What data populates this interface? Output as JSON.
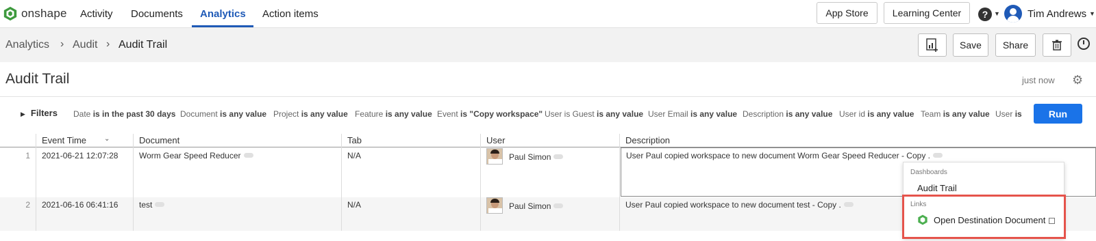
{
  "nav": {
    "brand": "onshape",
    "items": [
      "Activity",
      "Documents",
      "Analytics",
      "Action items"
    ],
    "active": "Analytics",
    "app_store": "App Store",
    "learning_center": "Learning Center",
    "help_icon": "question-circle-icon",
    "user_name": "Tim Andrews"
  },
  "breadcrumb": [
    "Analytics",
    "Audit",
    "Audit Trail"
  ],
  "toolbar": {
    "save": "Save",
    "share": "Share"
  },
  "page": {
    "title": "Audit Trail",
    "updated": "just now"
  },
  "filters": {
    "toggle_label": "Filters",
    "items": [
      {
        "name": "Date",
        "rest": "is in the past 30 days"
      },
      {
        "name": "Document",
        "rest": "is any value"
      },
      {
        "name": "Project",
        "rest": "is any value"
      },
      {
        "name": "Feature",
        "rest": "is any value"
      },
      {
        "name": "Event",
        "rest": "is \"Copy workspace\""
      },
      {
        "name": "User is Guest",
        "rest": "is any value"
      },
      {
        "name": "User Email",
        "rest": "is any value"
      },
      {
        "name": "Description",
        "rest": "is any value"
      },
      {
        "name": "User id",
        "rest": "is any value"
      },
      {
        "name": "Team",
        "rest": "is any value"
      },
      {
        "name": "User",
        "rest": "is"
      }
    ],
    "run": "Run"
  },
  "table": {
    "columns": [
      "Event Time",
      "Document",
      "Tab",
      "User",
      "Description"
    ],
    "rows": [
      {
        "n": "1",
        "time": "2021-06-21 12:07:28",
        "document": "Worm Gear Speed Reducer",
        "tab": "N/A",
        "user": "Paul Simon",
        "description": "User Paul copied workspace to new document Worm Gear Speed Reducer - Copy ."
      },
      {
        "n": "2",
        "time": "2021-06-16 06:41:16",
        "document": "test",
        "tab": "N/A",
        "user": "Paul Simon",
        "description": "User Paul copied workspace to new document test - Copy ."
      }
    ]
  },
  "popup": {
    "dashboards_label": "Dashboards",
    "dashboard_item": "Audit Trail",
    "links_label": "Links",
    "link_item": "Open Destination Document"
  },
  "colors": {
    "accent": "#1f5ab7",
    "run_button": "#1a73e8",
    "highlight": "#e5534b",
    "onshape_green": "#4caf50"
  }
}
